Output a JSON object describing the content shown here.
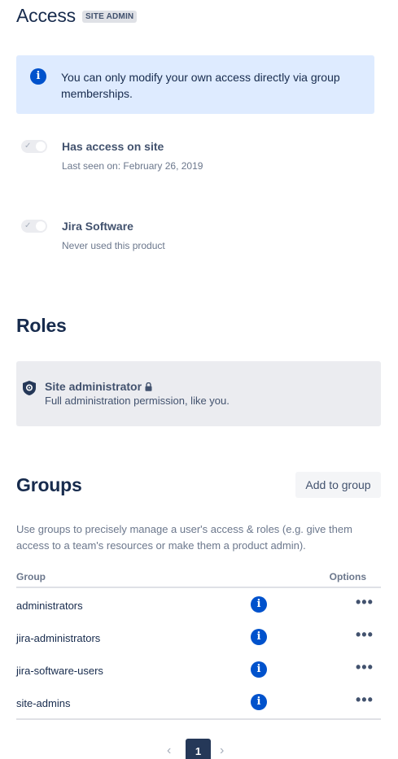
{
  "access": {
    "title": "Access",
    "badge": "SITE ADMIN",
    "banner": {
      "icon": "info-icon",
      "icon_glyph": "i",
      "text": "You can only modify your own access directly via group memberships."
    },
    "products": [
      {
        "name": "Has access on site",
        "subtitle": "Last seen on: February 26, 2019",
        "enabled": true
      },
      {
        "name": "Jira Software",
        "subtitle": "Never used this product",
        "enabled": true
      }
    ]
  },
  "roles": {
    "title": "Roles",
    "items": [
      {
        "name": "Site administrator",
        "description": "Full administration permission, like you.",
        "icon": "shield-icon",
        "locked": true
      }
    ]
  },
  "groups": {
    "title": "Groups",
    "add_button": "Add to group",
    "description": "Use groups to precisely manage a user's access & roles (e.g. give them access to a team's resources or make them a product admin).",
    "columns": {
      "group": "Group",
      "options": "Options"
    },
    "rows": [
      {
        "name": "administrators"
      },
      {
        "name": "jira-administrators"
      },
      {
        "name": "jira-software-users"
      },
      {
        "name": "site-admins"
      }
    ],
    "row_info_glyph": "i",
    "row_more_glyph": "•••"
  },
  "pagination": {
    "prev_glyph": "‹",
    "current_page": "1",
    "next_glyph": "›"
  },
  "colors": {
    "primary": "#0052CC",
    "text": "#172B4D",
    "subtle_text": "#6B778C",
    "info_bg": "#DEEBFF",
    "card_bg": "#EBECF0",
    "page_active": "#253858"
  }
}
